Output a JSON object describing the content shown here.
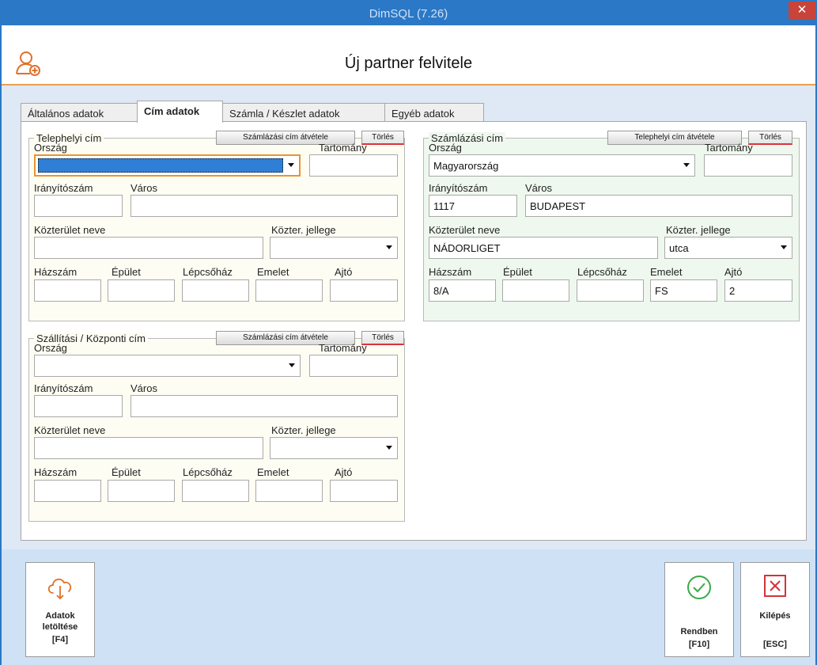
{
  "window": {
    "title": "DimSQL (7.26)",
    "close_glyph": "✕"
  },
  "header": {
    "title": "Új partner felvitele",
    "icon": "user-add-icon"
  },
  "tabs": [
    {
      "label": "Általános adatok"
    },
    {
      "label": "Cím adatok"
    },
    {
      "label": "Számla / Készlet adatok"
    },
    {
      "label": "Egyéb adatok"
    }
  ],
  "labels": {
    "country": "Ország",
    "county": "Tartomány",
    "zip": "Irányítószám",
    "city": "Város",
    "street_name": "Közterület neve",
    "street_type": "Közter. jellege",
    "house_no": "Házszám",
    "building": "Épület",
    "staircase": "Lépcsőház",
    "floor": "Emelet",
    "door": "Ajtó"
  },
  "site_address": {
    "legend": "Telephelyi cím",
    "copy_button": "Számlázási cím átvétele",
    "delete_button": "Törlés",
    "country": "",
    "county": "",
    "zip": "",
    "city": "",
    "street_name": "",
    "street_type": "",
    "house_no": "",
    "building": "",
    "staircase": "",
    "floor": "",
    "door": ""
  },
  "billing_address": {
    "legend": "Számlázási cím",
    "copy_button": "Telephelyi cím átvétele",
    "delete_button": "Törlés",
    "country": "Magyarország",
    "county": "",
    "zip": "1117",
    "city": "BUDAPEST",
    "street_name": "NÁDORLIGET",
    "street_type": "utca",
    "house_no": "8/A",
    "building": "",
    "staircase": "",
    "floor": "FS",
    "door": "2"
  },
  "shipping_address": {
    "legend": "Szállítási / Központi cím",
    "copy_button": "Számlázási cím átvétele",
    "delete_button": "Törlés",
    "country": "",
    "county": "",
    "zip": "",
    "city": "",
    "street_name": "",
    "street_type": "",
    "house_no": "",
    "building": "",
    "staircase": "",
    "floor": "",
    "door": ""
  },
  "footer": {
    "download": {
      "line1": "Adatok",
      "line2": "letöltése",
      "line3": "[F4]",
      "icon": "cloud-download-icon"
    },
    "ok": {
      "line1": "Rendben",
      "line2": "[F10]",
      "icon": "check-circle-icon"
    },
    "exit": {
      "line1": "Kilépés",
      "line2": "[ESC]",
      "icon": "close-box-icon"
    }
  },
  "colors": {
    "titlebar": "#2b78c6",
    "accent_line": "#e8a050",
    "body_bg": "#dfe8f5",
    "footer_bg": "#cfe1f5",
    "ok_green": "#3aaa46",
    "exit_red": "#d0343a"
  }
}
